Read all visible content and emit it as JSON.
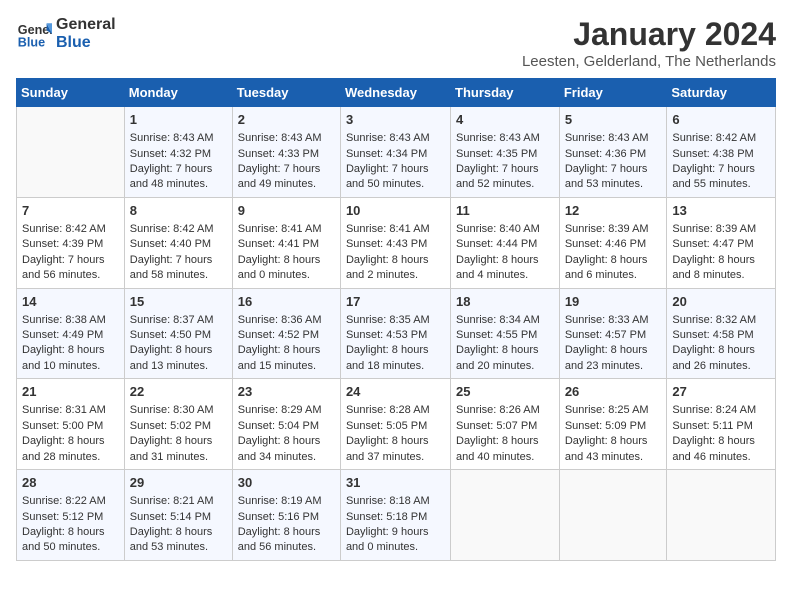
{
  "logo": {
    "line1": "General",
    "line2": "Blue"
  },
  "title": "January 2024",
  "subtitle": "Leesten, Gelderland, The Netherlands",
  "days_of_week": [
    "Sunday",
    "Monday",
    "Tuesday",
    "Wednesday",
    "Thursday",
    "Friday",
    "Saturday"
  ],
  "weeks": [
    [
      {
        "day": "",
        "sunrise": "",
        "sunset": "",
        "daylight": ""
      },
      {
        "day": "1",
        "sunrise": "Sunrise: 8:43 AM",
        "sunset": "Sunset: 4:32 PM",
        "daylight": "Daylight: 7 hours and 48 minutes."
      },
      {
        "day": "2",
        "sunrise": "Sunrise: 8:43 AM",
        "sunset": "Sunset: 4:33 PM",
        "daylight": "Daylight: 7 hours and 49 minutes."
      },
      {
        "day": "3",
        "sunrise": "Sunrise: 8:43 AM",
        "sunset": "Sunset: 4:34 PM",
        "daylight": "Daylight: 7 hours and 50 minutes."
      },
      {
        "day": "4",
        "sunrise": "Sunrise: 8:43 AM",
        "sunset": "Sunset: 4:35 PM",
        "daylight": "Daylight: 7 hours and 52 minutes."
      },
      {
        "day": "5",
        "sunrise": "Sunrise: 8:43 AM",
        "sunset": "Sunset: 4:36 PM",
        "daylight": "Daylight: 7 hours and 53 minutes."
      },
      {
        "day": "6",
        "sunrise": "Sunrise: 8:42 AM",
        "sunset": "Sunset: 4:38 PM",
        "daylight": "Daylight: 7 hours and 55 minutes."
      }
    ],
    [
      {
        "day": "7",
        "sunrise": "Sunrise: 8:42 AM",
        "sunset": "Sunset: 4:39 PM",
        "daylight": "Daylight: 7 hours and 56 minutes."
      },
      {
        "day": "8",
        "sunrise": "Sunrise: 8:42 AM",
        "sunset": "Sunset: 4:40 PM",
        "daylight": "Daylight: 7 hours and 58 minutes."
      },
      {
        "day": "9",
        "sunrise": "Sunrise: 8:41 AM",
        "sunset": "Sunset: 4:41 PM",
        "daylight": "Daylight: 8 hours and 0 minutes."
      },
      {
        "day": "10",
        "sunrise": "Sunrise: 8:41 AM",
        "sunset": "Sunset: 4:43 PM",
        "daylight": "Daylight: 8 hours and 2 minutes."
      },
      {
        "day": "11",
        "sunrise": "Sunrise: 8:40 AM",
        "sunset": "Sunset: 4:44 PM",
        "daylight": "Daylight: 8 hours and 4 minutes."
      },
      {
        "day": "12",
        "sunrise": "Sunrise: 8:39 AM",
        "sunset": "Sunset: 4:46 PM",
        "daylight": "Daylight: 8 hours and 6 minutes."
      },
      {
        "day": "13",
        "sunrise": "Sunrise: 8:39 AM",
        "sunset": "Sunset: 4:47 PM",
        "daylight": "Daylight: 8 hours and 8 minutes."
      }
    ],
    [
      {
        "day": "14",
        "sunrise": "Sunrise: 8:38 AM",
        "sunset": "Sunset: 4:49 PM",
        "daylight": "Daylight: 8 hours and 10 minutes."
      },
      {
        "day": "15",
        "sunrise": "Sunrise: 8:37 AM",
        "sunset": "Sunset: 4:50 PM",
        "daylight": "Daylight: 8 hours and 13 minutes."
      },
      {
        "day": "16",
        "sunrise": "Sunrise: 8:36 AM",
        "sunset": "Sunset: 4:52 PM",
        "daylight": "Daylight: 8 hours and 15 minutes."
      },
      {
        "day": "17",
        "sunrise": "Sunrise: 8:35 AM",
        "sunset": "Sunset: 4:53 PM",
        "daylight": "Daylight: 8 hours and 18 minutes."
      },
      {
        "day": "18",
        "sunrise": "Sunrise: 8:34 AM",
        "sunset": "Sunset: 4:55 PM",
        "daylight": "Daylight: 8 hours and 20 minutes."
      },
      {
        "day": "19",
        "sunrise": "Sunrise: 8:33 AM",
        "sunset": "Sunset: 4:57 PM",
        "daylight": "Daylight: 8 hours and 23 minutes."
      },
      {
        "day": "20",
        "sunrise": "Sunrise: 8:32 AM",
        "sunset": "Sunset: 4:58 PM",
        "daylight": "Daylight: 8 hours and 26 minutes."
      }
    ],
    [
      {
        "day": "21",
        "sunrise": "Sunrise: 8:31 AM",
        "sunset": "Sunset: 5:00 PM",
        "daylight": "Daylight: 8 hours and 28 minutes."
      },
      {
        "day": "22",
        "sunrise": "Sunrise: 8:30 AM",
        "sunset": "Sunset: 5:02 PM",
        "daylight": "Daylight: 8 hours and 31 minutes."
      },
      {
        "day": "23",
        "sunrise": "Sunrise: 8:29 AM",
        "sunset": "Sunset: 5:04 PM",
        "daylight": "Daylight: 8 hours and 34 minutes."
      },
      {
        "day": "24",
        "sunrise": "Sunrise: 8:28 AM",
        "sunset": "Sunset: 5:05 PM",
        "daylight": "Daylight: 8 hours and 37 minutes."
      },
      {
        "day": "25",
        "sunrise": "Sunrise: 8:26 AM",
        "sunset": "Sunset: 5:07 PM",
        "daylight": "Daylight: 8 hours and 40 minutes."
      },
      {
        "day": "26",
        "sunrise": "Sunrise: 8:25 AM",
        "sunset": "Sunset: 5:09 PM",
        "daylight": "Daylight: 8 hours and 43 minutes."
      },
      {
        "day": "27",
        "sunrise": "Sunrise: 8:24 AM",
        "sunset": "Sunset: 5:11 PM",
        "daylight": "Daylight: 8 hours and 46 minutes."
      }
    ],
    [
      {
        "day": "28",
        "sunrise": "Sunrise: 8:22 AM",
        "sunset": "Sunset: 5:12 PM",
        "daylight": "Daylight: 8 hours and 50 minutes."
      },
      {
        "day": "29",
        "sunrise": "Sunrise: 8:21 AM",
        "sunset": "Sunset: 5:14 PM",
        "daylight": "Daylight: 8 hours and 53 minutes."
      },
      {
        "day": "30",
        "sunrise": "Sunrise: 8:19 AM",
        "sunset": "Sunset: 5:16 PM",
        "daylight": "Daylight: 8 hours and 56 minutes."
      },
      {
        "day": "31",
        "sunrise": "Sunrise: 8:18 AM",
        "sunset": "Sunset: 5:18 PM",
        "daylight": "Daylight: 9 hours and 0 minutes."
      },
      {
        "day": "",
        "sunrise": "",
        "sunset": "",
        "daylight": ""
      },
      {
        "day": "",
        "sunrise": "",
        "sunset": "",
        "daylight": ""
      },
      {
        "day": "",
        "sunrise": "",
        "sunset": "",
        "daylight": ""
      }
    ]
  ]
}
